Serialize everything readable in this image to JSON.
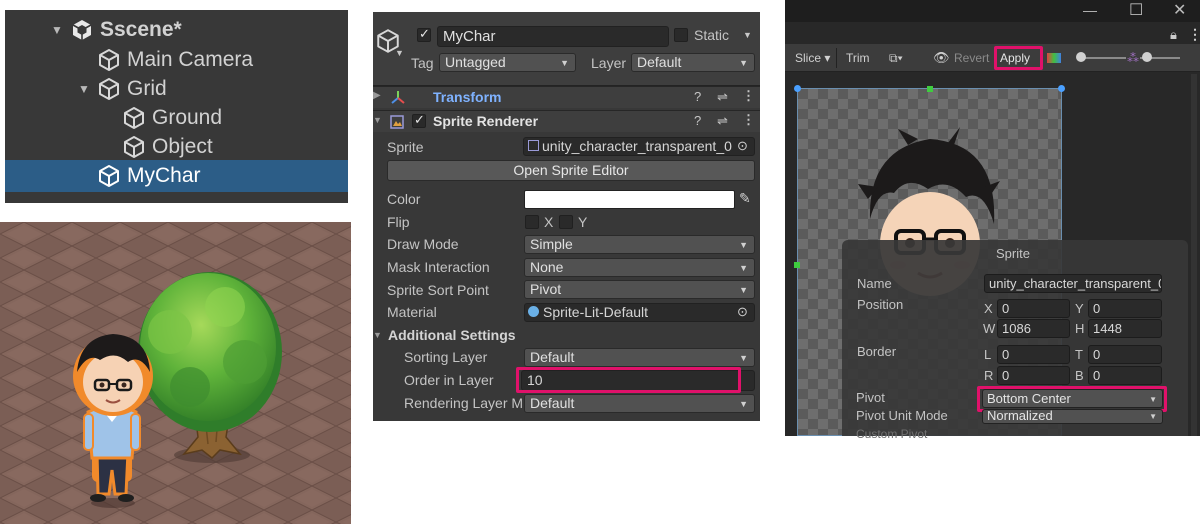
{
  "hierarchy": {
    "scene": "Sscene*",
    "items": [
      {
        "label": "Main Camera"
      },
      {
        "label": "Grid"
      },
      {
        "label": "Ground"
      },
      {
        "label": "Object"
      },
      {
        "label": "MyChar"
      }
    ]
  },
  "inspector": {
    "object_name": "MyChar",
    "static_label": "Static",
    "tag_label": "Tag",
    "tag_value": "Untagged",
    "layer_label": "Layer",
    "layer_value": "Default",
    "transform_title": "Transform",
    "sprite_renderer_title": "Sprite Renderer",
    "fields": {
      "sprite_label": "Sprite",
      "sprite_value": "unity_character_transparent_0",
      "open_sprite_editor": "Open Sprite Editor",
      "color_label": "Color",
      "flip_label": "Flip",
      "flip_x": "X",
      "flip_y": "Y",
      "draw_mode_label": "Draw Mode",
      "draw_mode_value": "Simple",
      "mask_label": "Mask Interaction",
      "mask_value": "None",
      "sort_point_label": "Sprite Sort Point",
      "sort_point_value": "Pivot",
      "material_label": "Material",
      "material_value": "Sprite-Lit-Default",
      "additional_settings": "Additional Settings",
      "sorting_layer_label": "Sorting Layer",
      "sorting_layer_value": "Default",
      "order_label": "Order in Layer",
      "order_value": "10",
      "rendering_layer_label": "Rendering Layer M",
      "rendering_layer_value": "Default"
    }
  },
  "sprite_editor": {
    "toolbar": {
      "slice": "Slice",
      "trim": "Trim",
      "revert": "Revert",
      "apply": "Apply"
    },
    "popup": {
      "title": "Sprite",
      "name_label": "Name",
      "name_value": "unity_character_transparent_0",
      "position_label": "Position",
      "x_label": "X",
      "x_value": "0",
      "y_label": "Y",
      "y_value": "0",
      "w_label": "W",
      "w_value": "1086",
      "h_label": "H",
      "h_value": "1448",
      "border_label": "Border",
      "l_label": "L",
      "l_value": "0",
      "t_label": "T",
      "t_value": "0",
      "r_label": "R",
      "r_value": "0",
      "b_label": "B",
      "b_value": "0",
      "pivot_label": "Pivot",
      "pivot_value": "Bottom Center",
      "pivot_unit_label": "Pivot Unit Mode",
      "pivot_unit_value": "Normalized",
      "custom_pivot_label": "Custom Pivot"
    }
  },
  "colors": {
    "highlight": "#e0116a",
    "selection": "#2c5d87",
    "transform_link": "#7fb2ff"
  },
  "icons": [
    "unity-logo-icon",
    "gameobject-cube-icon",
    "help-icon",
    "settings-sliders-icon",
    "more-icon",
    "object-picker-icon",
    "eyedropper-icon",
    "eye-icon",
    "lock-icon",
    "maximize-icon",
    "close-icon"
  ]
}
